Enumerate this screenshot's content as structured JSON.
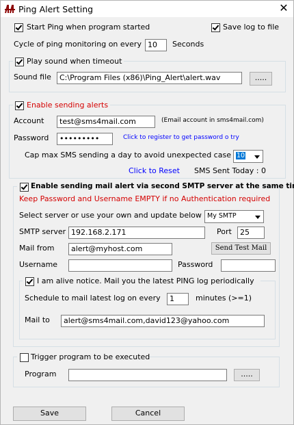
{
  "window": {
    "title": "Ping Alert Setting",
    "close_label": "✕"
  },
  "general": {
    "start_ping_label": "Start Ping when program started",
    "save_log_label": "Save log to file",
    "cycle_label": "Cycle of ping monitoring on every",
    "cycle_value": "10",
    "cycle_unit": "Seconds"
  },
  "sound": {
    "play_label": "Play sound when timeout",
    "file_label": "Sound file",
    "file_value": "C:\\Program Files (x86)\\Ping_Alert\\alert.wav",
    "browse_label": "....."
  },
  "alerts": {
    "enable_label": "Enable sending alerts",
    "account_label": "Account",
    "account_value": "test@sms4mail.com",
    "account_hint": "(Email account in sms4mail.com)",
    "password_label": "Password",
    "password_value": "•••••••••",
    "register_link": "Click to register to get password o try",
    "cap_label": "Cap max SMS sending a day to avoid unexpected case",
    "cap_value": "10",
    "reset_link": "Click to  Reset",
    "sms_sent_label": "SMS Sent Today : 0"
  },
  "smtp": {
    "enable_label": "Enable sending mail alert via second SMTP server at the same time",
    "warning": "Keep Password and Username EMPTY if no Authentication required",
    "select_label": "Select server or use your own and update below",
    "select_value": "My SMTP",
    "server_label": "SMTP server",
    "server_value": "192.168.2.171",
    "port_label": "Port",
    "port_value": "25",
    "mailfrom_label": "Mail from",
    "mailfrom_value": "alert@myhost.com",
    "test_button": "Send Test Mail",
    "username_label": "Username",
    "username_value": "",
    "password_label": "Password",
    "password_value": ""
  },
  "alive": {
    "enable_label": "I am alive notice. Mail you the latest PING log  periodically",
    "schedule_label": "Schedule to mail latest log on every",
    "schedule_value": "1",
    "schedule_unit": "minutes (>=1)",
    "mailto_label": "Mail to",
    "mailto_value": "alert@sms4mail.com,david123@yahoo.com"
  },
  "trigger": {
    "enable_label": "Trigger program to be executed",
    "program_label": "Program",
    "program_value": "",
    "browse_label": "....."
  },
  "footer": {
    "save_label": "Save",
    "cancel_label": "Cancel"
  }
}
